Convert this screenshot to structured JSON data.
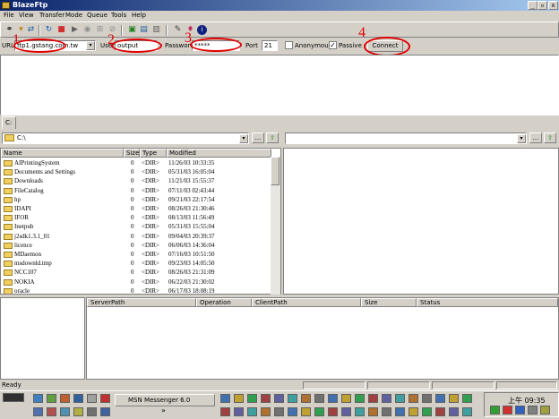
{
  "window": {
    "title": "BlazeFtp",
    "min": "_",
    "max": "▫",
    "close": "x"
  },
  "menu": [
    "File",
    "View",
    "Transfer",
    "Mode",
    "Queue",
    "Tools",
    "Help"
  ],
  "connection": {
    "url_label": "URL",
    "url_value": "ftp1.gstang.com.tw",
    "user_label": "User",
    "user_value": "output",
    "password_label": "Password",
    "password_value": "*****",
    "port_label": "Port",
    "port_value": "21",
    "anonymous_label": "Anonymous",
    "passive_label": "Passive",
    "passive_checked": "✓",
    "connect_label": "Connect"
  },
  "annotations": [
    "1",
    "2",
    "3",
    "4"
  ],
  "local": {
    "tab": "C:",
    "path": "C:\\",
    "headers": {
      "name": "Name",
      "size": "Size",
      "type": "Type",
      "modified": "Modified"
    },
    "files": [
      {
        "name": "AIPrintingSystem",
        "size": "0",
        "type": "<DIR>",
        "modified": "11/26/03 10:33:35"
      },
      {
        "name": "Documents and Settings",
        "size": "0",
        "type": "<DIR>",
        "modified": "05/31/03 16:05:04"
      },
      {
        "name": "Downloads",
        "size": "0",
        "type": "<DIR>",
        "modified": "11/21/03 15:55:37"
      },
      {
        "name": "FileCatalog",
        "size": "0",
        "type": "<DIR>",
        "modified": "07/11/03 02:43:44"
      },
      {
        "name": "hp",
        "size": "0",
        "type": "<DIR>",
        "modified": "09/21/03 22:17:54"
      },
      {
        "name": "IDAPI",
        "size": "0",
        "type": "<DIR>",
        "modified": "08/26/03 21:30:46"
      },
      {
        "name": "IFOR",
        "size": "0",
        "type": "<DIR>",
        "modified": "08/13/03 11:56:49"
      },
      {
        "name": "Inetpub",
        "size": "0",
        "type": "<DIR>",
        "modified": "05/31/03 15:55:04"
      },
      {
        "name": "j2sdk1.3.1_01",
        "size": "0",
        "type": "<DIR>",
        "modified": "09/04/03 20:39:37"
      },
      {
        "name": "licence",
        "size": "0",
        "type": "<DIR>",
        "modified": "06/06/03 14:36:04"
      },
      {
        "name": "MDaemon",
        "size": "0",
        "type": "<DIR>",
        "modified": "07/16/03 10:51:50"
      },
      {
        "name": "msdownld.tmp",
        "size": "0",
        "type": "<DIR>",
        "modified": "09/23/03 14:05:50"
      },
      {
        "name": "NCC107",
        "size": "0",
        "type": "<DIR>",
        "modified": "08/26/03 21:31:09"
      },
      {
        "name": "NOKIA",
        "size": "0",
        "type": "<DIR>",
        "modified": "06/22/03 21:30:02"
      },
      {
        "name": "oracle",
        "size": "0",
        "type": "<DIR>",
        "modified": "06/17/03 18:08:19"
      }
    ]
  },
  "queue": {
    "headers": [
      "ServerPath",
      "Operation",
      "ClientPath",
      "Size",
      "Status"
    ]
  },
  "status": {
    "text": "Ready"
  },
  "taskbar": {
    "msn": "MSN Messenger 6.0",
    "clock": "上午 09:35",
    "expand": "»"
  },
  "buttons": {
    "browse": "...",
    "up": "⇧",
    "dropdown": "▾"
  },
  "colors": {
    "annotation": "#e00000",
    "titlebar": "#0a246a",
    "folder": "#f0d060"
  }
}
